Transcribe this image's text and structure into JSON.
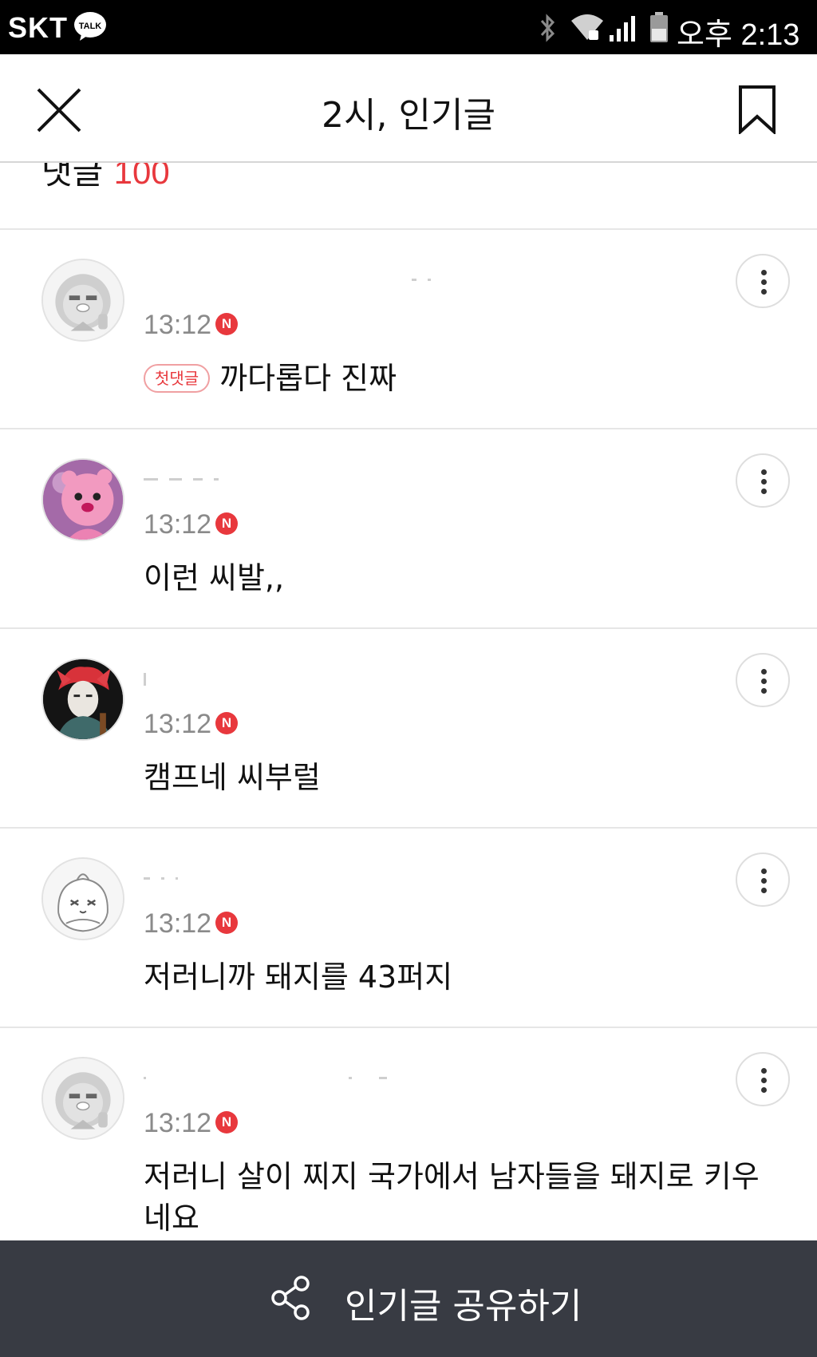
{
  "status_bar": {
    "carrier": "SKT",
    "talk_badge": "TALK",
    "clock": "오후 2:13",
    "icons": [
      "kakaotalk-icon",
      "bluetooth-icon",
      "wifi-icon",
      "signal-icon",
      "battery-icon"
    ]
  },
  "header": {
    "title": "2시, 인기글",
    "close_icon": "close-icon",
    "bookmark_icon": "bookmark-icon"
  },
  "comment_count": {
    "label": "댓글",
    "count": "100"
  },
  "comments": [
    {
      "time": "13:12",
      "new_badge": "N",
      "first_badge": "첫댓글",
      "text": "까다롭다 진짜",
      "avatar": "ryan-icon"
    },
    {
      "time": "13:12",
      "new_badge": "N",
      "text": "이런 씨발,,",
      "avatar": "pink-bear-avatar"
    },
    {
      "time": "13:12",
      "new_badge": "N",
      "text": "캠프네 씨부럴",
      "avatar": "red-hair-person-avatar"
    },
    {
      "time": "13:12",
      "new_badge": "N",
      "text": "저러니까 돼지를 43퍼지",
      "avatar": "apeach-icon"
    },
    {
      "time": "13:12",
      "new_badge": "N",
      "text": "저러니 살이 찌지 국가에서 남자들을 돼지로 키우네요",
      "avatar": "ryan-icon"
    }
  ],
  "share_bar": {
    "label": "인기글 공유하기",
    "icon": "share-icon"
  },
  "colors": {
    "accent_red": "#e8383d",
    "share_bar_bg": "#383b43",
    "time_gray": "#8a8a8a"
  }
}
